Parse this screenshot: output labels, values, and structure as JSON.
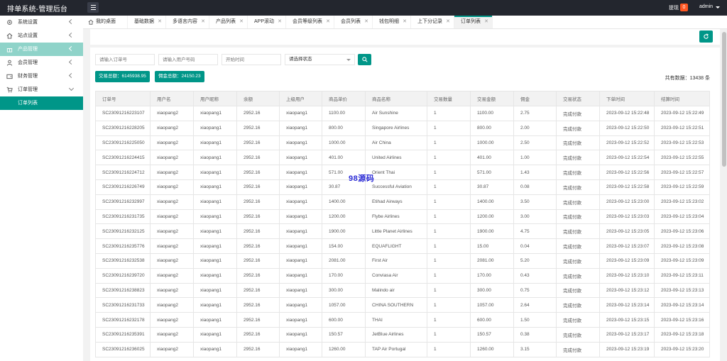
{
  "header": {
    "title": "排单系统-管理后台",
    "withdraw_label": "提现",
    "withdraw_count": "0",
    "user": "admin"
  },
  "sidebar": {
    "items": [
      {
        "label": "系统设置",
        "icon": "gear-icon",
        "expanded": false
      },
      {
        "label": "站点设置",
        "icon": "home-icon",
        "expanded": false
      },
      {
        "label": "产品管理",
        "icon": "gift-icon",
        "expanded": false
      },
      {
        "label": "会员管理",
        "icon": "user-icon",
        "expanded": false
      },
      {
        "label": "财务管理",
        "icon": "wallet-icon",
        "expanded": false
      },
      {
        "label": "订单管理",
        "icon": "cart-icon",
        "expanded": true
      }
    ],
    "subitem": "订单列表"
  },
  "tabs": [
    {
      "label": "我的桌面",
      "closable": false
    },
    {
      "label": "基础数据",
      "closable": true
    },
    {
      "label": "多语言内容",
      "closable": true
    },
    {
      "label": "产品列表",
      "closable": true
    },
    {
      "label": "APP滚动",
      "closable": true
    },
    {
      "label": "会员等级列表",
      "closable": true
    },
    {
      "label": "会员列表",
      "closable": true
    },
    {
      "label": "钱包明细",
      "closable": true
    },
    {
      "label": "上下分记录",
      "closable": true
    },
    {
      "label": "订单列表",
      "closable": true,
      "active": true
    }
  ],
  "search": {
    "order_placeholder": "请输入订单号",
    "user_placeholder": "请输入用户号码",
    "time_placeholder": "开始时间",
    "status_placeholder": "请选择状态"
  },
  "stats": {
    "trade_total": "交易总额：6145938.95",
    "commission_total": "佣金总额：24150.23",
    "total_records": "共有数据：13438 条"
  },
  "table": {
    "columns": [
      "订单号",
      "用户名",
      "用户昵称",
      "余额",
      "上级用户",
      "商品单价",
      "商品名称",
      "交易数量",
      "交易金额",
      "佣金",
      "交易状态",
      "下单时间",
      "结算时间"
    ],
    "rows": [
      [
        "SC23091216223107",
        "xiaopang2",
        "xiaopang1",
        "2952.16",
        "xiaopang1",
        "1100.00",
        "Air Sunshine",
        "1",
        "1100.00",
        "2.75",
        "完成付款",
        "2023-09-12 15:22:48",
        "2023-09-12 15:22:49"
      ],
      [
        "SC23091216228205",
        "xiaopang2",
        "xiaopang1",
        "2952.16",
        "xiaopang1",
        "800.00",
        "Singapore Airlines",
        "1",
        "800.00",
        "2.00",
        "完成付款",
        "2023-09-12 15:22:50",
        "2023-09-12 15:22:51"
      ],
      [
        "SC23091216225050",
        "xiaopang2",
        "xiaopang1",
        "2952.16",
        "xiaopang1",
        "1000.00",
        "Air China",
        "1",
        "1000.00",
        "2.50",
        "完成付款",
        "2023-09-12 15:22:52",
        "2023-09-12 15:22:53"
      ],
      [
        "SC23091216224415",
        "xiaopang2",
        "xiaopang1",
        "2952.16",
        "xiaopang1",
        "401.00",
        "United Airlines",
        "1",
        "401.00",
        "1.00",
        "完成付款",
        "2023-09-12 15:22:54",
        "2023-09-12 15:22:55"
      ],
      [
        "SC23091216224712",
        "xiaopang2",
        "xiaopang1",
        "2952.16",
        "xiaopang1",
        "571.00",
        "Orient Thai",
        "1",
        "571.00",
        "1.43",
        "完成付款",
        "2023-09-12 15:22:56",
        "2023-09-12 15:22:57"
      ],
      [
        "SC23091216226749",
        "xiaopang2",
        "xiaopang1",
        "2952.16",
        "xiaopang1",
        "30.87",
        "Successful Aviation",
        "1",
        "30.87",
        "0.08",
        "完成付款",
        "2023-09-12 15:22:58",
        "2023-09-12 15:22:59"
      ],
      [
        "SC23091216232997",
        "xiaopang2",
        "xiaopang1",
        "2952.16",
        "xiaopang1",
        "1400.00",
        "Etihad Airways",
        "1",
        "1400.00",
        "3.50",
        "完成付款",
        "2023-09-12 15:23:00",
        "2023-09-12 15:23:02"
      ],
      [
        "SC23091216231735",
        "xiaopang2",
        "xiaopang1",
        "2952.16",
        "xiaopang1",
        "1200.00",
        "Flybe Airlines",
        "1",
        "1200.00",
        "3.00",
        "完成付款",
        "2023-09-12 15:23:03",
        "2023-09-12 15:23:04"
      ],
      [
        "SC23091216232125",
        "xiaopang2",
        "xiaopang1",
        "2952.16",
        "xiaopang1",
        "1900.00",
        "Little Planet Airlines",
        "1",
        "1900.00",
        "4.75",
        "完成付款",
        "2023-09-12 15:23:05",
        "2023-09-12 15:23:06"
      ],
      [
        "SC23091216235776",
        "xiaopang2",
        "xiaopang1",
        "2952.16",
        "xiaopang1",
        "154.00",
        "EQUAFLIGHT",
        "1",
        "15.00",
        "0.04",
        "完成付款",
        "2023-09-12 15:23:07",
        "2023-09-12 15:23:08"
      ],
      [
        "SC23091216232538",
        "xiaopang2",
        "xiaopang1",
        "2952.16",
        "xiaopang1",
        "2081.00",
        "First Air",
        "1",
        "2081.00",
        "5.20",
        "完成付款",
        "2023-09-12 15:23:09",
        "2023-09-12 15:23:09"
      ],
      [
        "SC23091216239720",
        "xiaopang2",
        "xiaopang1",
        "2952.16",
        "xiaopang1",
        "170.00",
        "Conviasa Air",
        "1",
        "170.00",
        "0.43",
        "完成付款",
        "2023-09-12 15:23:10",
        "2023-09-12 15:23:11"
      ],
      [
        "SC23091216238823",
        "xiaopang2",
        "xiaopang1",
        "2952.16",
        "xiaopang1",
        "300.00",
        "Malindo air",
        "1",
        "300.00",
        "0.75",
        "完成付款",
        "2023-09-12 15:23:12",
        "2023-09-12 15:23:13"
      ],
      [
        "SC23091216231733",
        "xiaopang2",
        "xiaopang1",
        "2952.16",
        "xiaopang1",
        "1057.00",
        "CHINA SOUTHERN",
        "1",
        "1057.00",
        "2.64",
        "完成付款",
        "2023-09-12 15:23:14",
        "2023-09-12 15:23:14"
      ],
      [
        "SC23091216232178",
        "xiaopang2",
        "xiaopang1",
        "2952.16",
        "xiaopang1",
        "600.00",
        "THAI",
        "1",
        "600.00",
        "1.50",
        "完成付款",
        "2023-09-12 15:23:15",
        "2023-09-12 15:23:16"
      ],
      [
        "SC23091216235391",
        "xiaopang2",
        "xiaopang1",
        "2952.16",
        "xiaopang1",
        "150.57",
        "JetBlue Airlines",
        "1",
        "150.57",
        "0.38",
        "完成付款",
        "2023-09-12 15:23:17",
        "2023-09-12 15:23:18"
      ],
      [
        "SC23091216236025",
        "xiaopang2",
        "xiaopang1",
        "2952.16",
        "xiaopang1",
        "1260.00",
        "TAP Air Portugal",
        "1",
        "1260.00",
        "3.15",
        "完成付款",
        "2023-09-12 15:23:19",
        "2023-09-12 15:23:20"
      ]
    ]
  },
  "watermark": "98源码",
  "colors": {
    "primary": "#009688",
    "topbar": "#23262e",
    "badge": "#ff5722",
    "active_group": "#8fd3c9"
  }
}
